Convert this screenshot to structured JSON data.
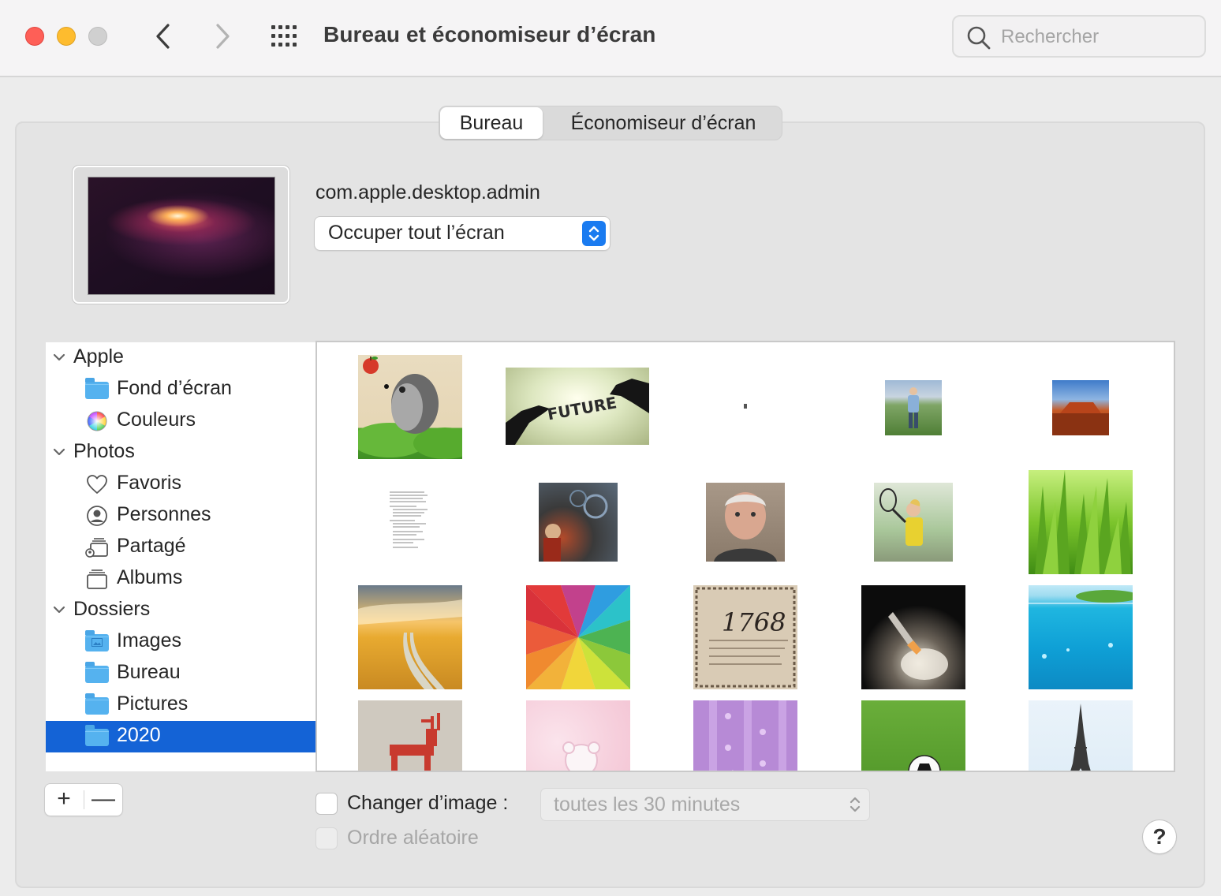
{
  "window": {
    "title": "Bureau et économiseur d’écran",
    "search_placeholder": "Rechercher"
  },
  "tabs": {
    "active": "Bureau",
    "other": "Économiseur d’écran"
  },
  "preview": {
    "name": "com.apple.desktop.admin",
    "fit_option": "Occuper tout l’écran"
  },
  "sidebar": {
    "sections": [
      {
        "label": "Apple",
        "items": [
          {
            "label": "Fond d’écran",
            "icon": "folder-icon"
          },
          {
            "label": "Couleurs",
            "icon": "color-wheel-icon"
          }
        ]
      },
      {
        "label": "Photos",
        "items": [
          {
            "label": "Favoris",
            "icon": "heart-icon"
          },
          {
            "label": "Personnes",
            "icon": "person-icon"
          },
          {
            "label": "Partagé",
            "icon": "shared-album-icon"
          },
          {
            "label": "Albums",
            "icon": "albums-icon"
          }
        ]
      },
      {
        "label": "Dossiers",
        "items": [
          {
            "label": "Images",
            "icon": "images-folder-icon"
          },
          {
            "label": "Bureau",
            "icon": "folder-icon"
          },
          {
            "label": "Pictures",
            "icon": "folder-icon"
          },
          {
            "label": "2020",
            "icon": "folder-icon",
            "selected": true
          }
        ]
      }
    ],
    "add_label": "+",
    "remove_label": "—"
  },
  "gallery": {
    "thumbnails": [
      {
        "name": "hedgehog-apple"
      },
      {
        "name": "future-hands"
      },
      {
        "name": "tiny-dot"
      },
      {
        "name": "man-meadow"
      },
      {
        "name": "red-rock-canyon"
      },
      {
        "name": "text-document"
      },
      {
        "name": "singer-stage"
      },
      {
        "name": "old-man-portrait"
      },
      {
        "name": "tennis-player"
      },
      {
        "name": "green-grass"
      },
      {
        "name": "wheat-field-path"
      },
      {
        "name": "color-rays"
      },
      {
        "name": "year-1768-old-print"
      },
      {
        "name": "shuttle-launch"
      },
      {
        "name": "underwater-island"
      },
      {
        "name": "cross-stitch-deer"
      },
      {
        "name": "pink-teddy-bear"
      },
      {
        "name": "purple-pattern"
      },
      {
        "name": "soccer-ball-grass"
      },
      {
        "name": "eiffel-tower"
      }
    ],
    "print_1768": "1768"
  },
  "options": {
    "change_picture_label": "Changer d’image :",
    "interval": "toutes les 30 minutes",
    "random_order_label": "Ordre aléatoire"
  },
  "help_label": "?",
  "colors": {
    "accent": "#1a7bf0",
    "selection": "#1463d6",
    "close": "#fe5f57",
    "minimize": "#febc2e"
  }
}
